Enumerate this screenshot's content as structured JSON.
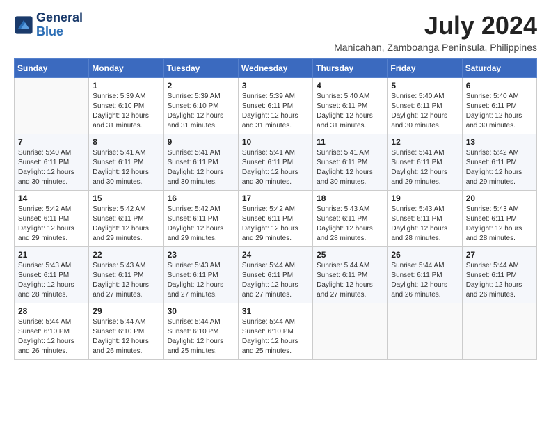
{
  "logo": {
    "line1": "General",
    "line2": "Blue"
  },
  "title": "July 2024",
  "subtitle": "Manicahan, Zamboanga Peninsula, Philippines",
  "days_of_week": [
    "Sunday",
    "Monday",
    "Tuesday",
    "Wednesday",
    "Thursday",
    "Friday",
    "Saturday"
  ],
  "weeks": [
    [
      {
        "day": "",
        "sunrise": "",
        "sunset": "",
        "daylight": ""
      },
      {
        "day": "1",
        "sunrise": "Sunrise: 5:39 AM",
        "sunset": "Sunset: 6:10 PM",
        "daylight": "Daylight: 12 hours and 31 minutes."
      },
      {
        "day": "2",
        "sunrise": "Sunrise: 5:39 AM",
        "sunset": "Sunset: 6:10 PM",
        "daylight": "Daylight: 12 hours and 31 minutes."
      },
      {
        "day": "3",
        "sunrise": "Sunrise: 5:39 AM",
        "sunset": "Sunset: 6:11 PM",
        "daylight": "Daylight: 12 hours and 31 minutes."
      },
      {
        "day": "4",
        "sunrise": "Sunrise: 5:40 AM",
        "sunset": "Sunset: 6:11 PM",
        "daylight": "Daylight: 12 hours and 31 minutes."
      },
      {
        "day": "5",
        "sunrise": "Sunrise: 5:40 AM",
        "sunset": "Sunset: 6:11 PM",
        "daylight": "Daylight: 12 hours and 30 minutes."
      },
      {
        "day": "6",
        "sunrise": "Sunrise: 5:40 AM",
        "sunset": "Sunset: 6:11 PM",
        "daylight": "Daylight: 12 hours and 30 minutes."
      }
    ],
    [
      {
        "day": "7",
        "sunrise": "Sunrise: 5:40 AM",
        "sunset": "Sunset: 6:11 PM",
        "daylight": "Daylight: 12 hours and 30 minutes."
      },
      {
        "day": "8",
        "sunrise": "Sunrise: 5:41 AM",
        "sunset": "Sunset: 6:11 PM",
        "daylight": "Daylight: 12 hours and 30 minutes."
      },
      {
        "day": "9",
        "sunrise": "Sunrise: 5:41 AM",
        "sunset": "Sunset: 6:11 PM",
        "daylight": "Daylight: 12 hours and 30 minutes."
      },
      {
        "day": "10",
        "sunrise": "Sunrise: 5:41 AM",
        "sunset": "Sunset: 6:11 PM",
        "daylight": "Daylight: 12 hours and 30 minutes."
      },
      {
        "day": "11",
        "sunrise": "Sunrise: 5:41 AM",
        "sunset": "Sunset: 6:11 PM",
        "daylight": "Daylight: 12 hours and 30 minutes."
      },
      {
        "day": "12",
        "sunrise": "Sunrise: 5:41 AM",
        "sunset": "Sunset: 6:11 PM",
        "daylight": "Daylight: 12 hours and 29 minutes."
      },
      {
        "day": "13",
        "sunrise": "Sunrise: 5:42 AM",
        "sunset": "Sunset: 6:11 PM",
        "daylight": "Daylight: 12 hours and 29 minutes."
      }
    ],
    [
      {
        "day": "14",
        "sunrise": "Sunrise: 5:42 AM",
        "sunset": "Sunset: 6:11 PM",
        "daylight": "Daylight: 12 hours and 29 minutes."
      },
      {
        "day": "15",
        "sunrise": "Sunrise: 5:42 AM",
        "sunset": "Sunset: 6:11 PM",
        "daylight": "Daylight: 12 hours and 29 minutes."
      },
      {
        "day": "16",
        "sunrise": "Sunrise: 5:42 AM",
        "sunset": "Sunset: 6:11 PM",
        "daylight": "Daylight: 12 hours and 29 minutes."
      },
      {
        "day": "17",
        "sunrise": "Sunrise: 5:42 AM",
        "sunset": "Sunset: 6:11 PM",
        "daylight": "Daylight: 12 hours and 29 minutes."
      },
      {
        "day": "18",
        "sunrise": "Sunrise: 5:43 AM",
        "sunset": "Sunset: 6:11 PM",
        "daylight": "Daylight: 12 hours and 28 minutes."
      },
      {
        "day": "19",
        "sunrise": "Sunrise: 5:43 AM",
        "sunset": "Sunset: 6:11 PM",
        "daylight": "Daylight: 12 hours and 28 minutes."
      },
      {
        "day": "20",
        "sunrise": "Sunrise: 5:43 AM",
        "sunset": "Sunset: 6:11 PM",
        "daylight": "Daylight: 12 hours and 28 minutes."
      }
    ],
    [
      {
        "day": "21",
        "sunrise": "Sunrise: 5:43 AM",
        "sunset": "Sunset: 6:11 PM",
        "daylight": "Daylight: 12 hours and 28 minutes."
      },
      {
        "day": "22",
        "sunrise": "Sunrise: 5:43 AM",
        "sunset": "Sunset: 6:11 PM",
        "daylight": "Daylight: 12 hours and 27 minutes."
      },
      {
        "day": "23",
        "sunrise": "Sunrise: 5:43 AM",
        "sunset": "Sunset: 6:11 PM",
        "daylight": "Daylight: 12 hours and 27 minutes."
      },
      {
        "day": "24",
        "sunrise": "Sunrise: 5:44 AM",
        "sunset": "Sunset: 6:11 PM",
        "daylight": "Daylight: 12 hours and 27 minutes."
      },
      {
        "day": "25",
        "sunrise": "Sunrise: 5:44 AM",
        "sunset": "Sunset: 6:11 PM",
        "daylight": "Daylight: 12 hours and 27 minutes."
      },
      {
        "day": "26",
        "sunrise": "Sunrise: 5:44 AM",
        "sunset": "Sunset: 6:11 PM",
        "daylight": "Daylight: 12 hours and 26 minutes."
      },
      {
        "day": "27",
        "sunrise": "Sunrise: 5:44 AM",
        "sunset": "Sunset: 6:11 PM",
        "daylight": "Daylight: 12 hours and 26 minutes."
      }
    ],
    [
      {
        "day": "28",
        "sunrise": "Sunrise: 5:44 AM",
        "sunset": "Sunset: 6:10 PM",
        "daylight": "Daylight: 12 hours and 26 minutes."
      },
      {
        "day": "29",
        "sunrise": "Sunrise: 5:44 AM",
        "sunset": "Sunset: 6:10 PM",
        "daylight": "Daylight: 12 hours and 26 minutes."
      },
      {
        "day": "30",
        "sunrise": "Sunrise: 5:44 AM",
        "sunset": "Sunset: 6:10 PM",
        "daylight": "Daylight: 12 hours and 25 minutes."
      },
      {
        "day": "31",
        "sunrise": "Sunrise: 5:44 AM",
        "sunset": "Sunset: 6:10 PM",
        "daylight": "Daylight: 12 hours and 25 minutes."
      },
      {
        "day": "",
        "sunrise": "",
        "sunset": "",
        "daylight": ""
      },
      {
        "day": "",
        "sunrise": "",
        "sunset": "",
        "daylight": ""
      },
      {
        "day": "",
        "sunrise": "",
        "sunset": "",
        "daylight": ""
      }
    ]
  ]
}
